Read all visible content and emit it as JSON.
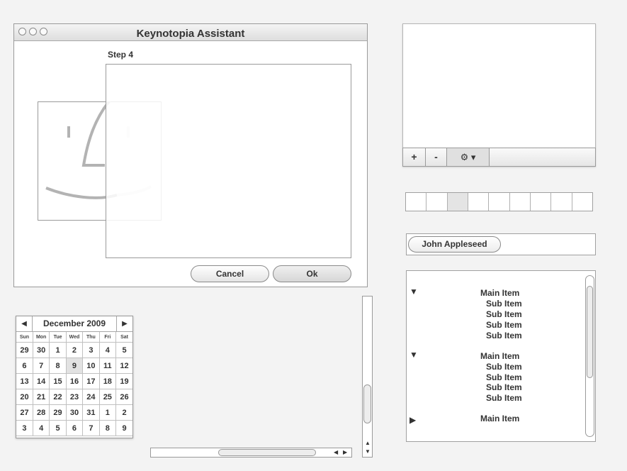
{
  "window": {
    "title": "Keynotopia Assistant",
    "step": "Step 4",
    "cancel_label": "Cancel",
    "ok_label": "Ok"
  },
  "listbox": {
    "add_label": "+",
    "remove_label": "-",
    "action_label": "⚙ ▾"
  },
  "token": {
    "label": "John Appleseed"
  },
  "outline": {
    "groups": [
      {
        "main": "Main Item",
        "expanded": true,
        "subs": [
          "Sub Item",
          "Sub Item",
          "Sub Item",
          "Sub Item"
        ]
      },
      {
        "main": "Main Item",
        "expanded": true,
        "subs": [
          "Sub Item",
          "Sub Item",
          "Sub Item",
          "Sub Item"
        ]
      },
      {
        "main": "Main Item",
        "expanded": false,
        "subs": []
      }
    ]
  },
  "calendar": {
    "title": "December 2009",
    "prev": "◀",
    "next": "▶",
    "weekdays": [
      "Sun",
      "Mon",
      "Tue",
      "Wed",
      "Thu",
      "Fri",
      "Sat"
    ],
    "weeks": [
      [
        "29",
        "30",
        "1",
        "2",
        "3",
        "4",
        "5"
      ],
      [
        "6",
        "7",
        "8",
        "9",
        "10",
        "11",
        "12"
      ],
      [
        "13",
        "14",
        "15",
        "16",
        "17",
        "18",
        "19"
      ],
      [
        "20",
        "21",
        "22",
        "23",
        "24",
        "25",
        "26"
      ],
      [
        "27",
        "28",
        "29",
        "30",
        "31",
        "1",
        "2"
      ],
      [
        "3",
        "4",
        "5",
        "6",
        "7",
        "8",
        "9"
      ]
    ],
    "selected_day": "9"
  },
  "scroll": {
    "left": "◀",
    "right": "▶",
    "up": "▲",
    "down": "▼"
  }
}
